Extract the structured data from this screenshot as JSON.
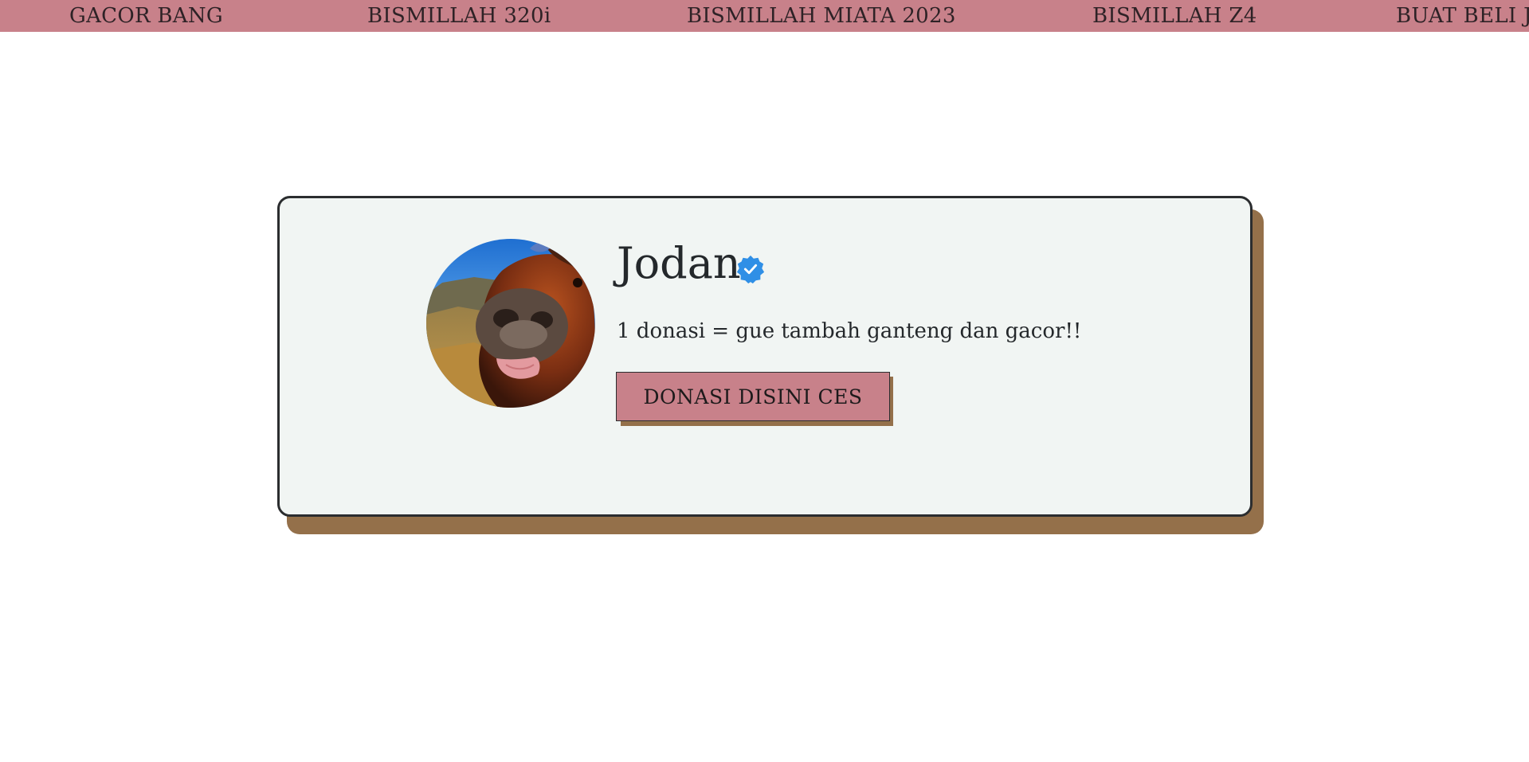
{
  "marquee": {
    "items": [
      "GACOR BANG",
      "BISMILLAH 320i",
      "BISMILLAH MIATA 2023",
      "BISMILLAH Z4",
      "BUAT BELI J"
    ]
  },
  "profile": {
    "name": "Jodan",
    "verified_icon": "verified-badge-icon",
    "bio": "1 donasi = gue tambah ganteng dan gacor!!",
    "avatar": "horse-photo-avatar"
  },
  "donate_button": {
    "label": "DONASI DISINI CES"
  },
  "colors": {
    "marquee_bg": "#c8818a",
    "card_bg": "#f1f5f3",
    "shadow": "#94704a",
    "button_bg": "#c8818a",
    "verified_blue": "#2f8fe6"
  }
}
